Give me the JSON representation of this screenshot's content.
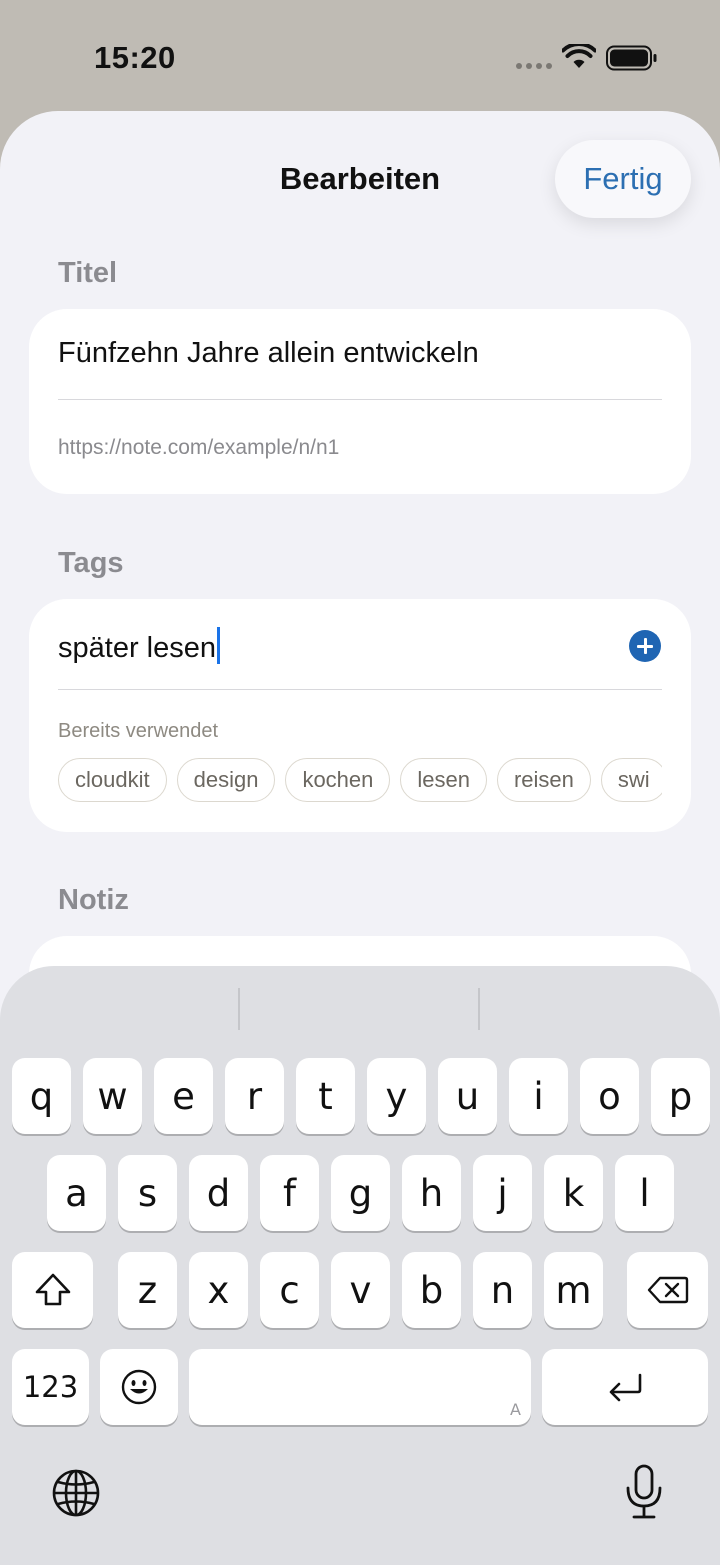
{
  "status_bar": {
    "time": "15:20"
  },
  "header": {
    "title": "Bearbeiten",
    "done_label": "Fertig"
  },
  "title_section": {
    "label": "Titel",
    "title_value": "Fünfzehn Jahre allein entwickeln",
    "url": "https://note.com/example/n/n1"
  },
  "tags_section": {
    "label": "Tags",
    "input_value": "später lesen",
    "used_label": "Bereits verwendet",
    "used_tags": [
      "cloudkit",
      "design",
      "kochen",
      "lesen",
      "reisen",
      "swi"
    ]
  },
  "note_section": {
    "label": "Notiz"
  },
  "keyboard": {
    "row1": [
      "q",
      "w",
      "e",
      "r",
      "t",
      "y",
      "u",
      "i",
      "o",
      "p"
    ],
    "row2": [
      "a",
      "s",
      "d",
      "f",
      "g",
      "h",
      "j",
      "k",
      "l"
    ],
    "row3": [
      "z",
      "x",
      "c",
      "v",
      "b",
      "n",
      "m"
    ],
    "numbers_label": "123",
    "space_corner": "A",
    "icons": [
      "shift-icon",
      "backspace-icon",
      "emoji-icon",
      "return-icon",
      "globe-icon",
      "microphone-icon"
    ]
  },
  "colors": {
    "accent": "#2c6fb2",
    "cursor": "#1a73e8",
    "sheet_bg": "#f2f2f7",
    "keyboard_bg": "#dedfe3"
  }
}
